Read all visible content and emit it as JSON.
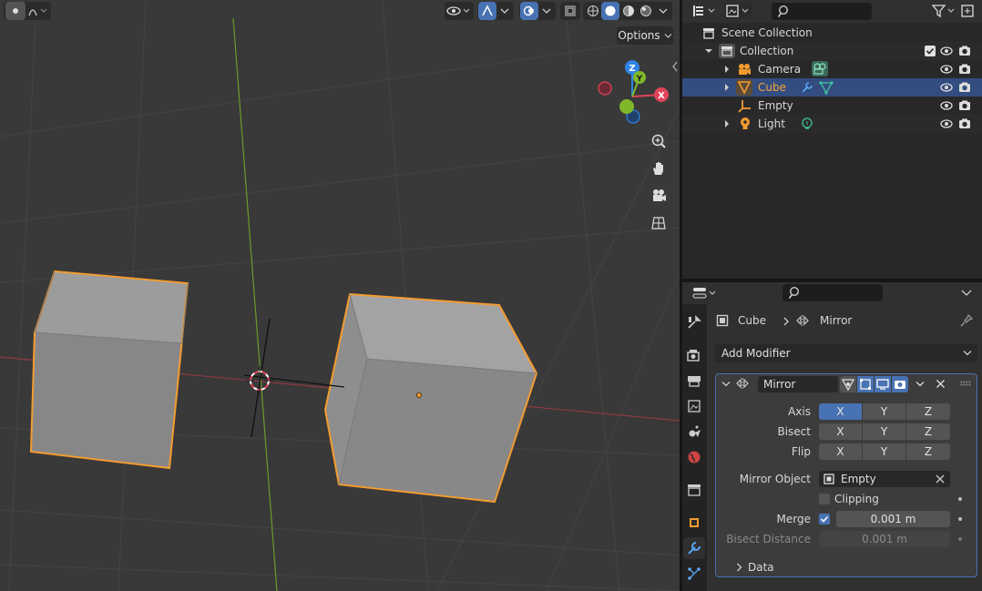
{
  "viewport": {
    "options_label": "Options",
    "gizmo": {
      "z": "Z",
      "y": "Y",
      "x": "X"
    }
  },
  "outliner": {
    "rows": [
      {
        "label": "Scene Collection",
        "icon": "scene-collection-icon"
      },
      {
        "label": "Collection",
        "icon": "collection-icon"
      },
      {
        "label": "Camera",
        "icon": "camera-object-icon"
      },
      {
        "label": "Cube",
        "icon": "mesh-object-icon",
        "selected": true
      },
      {
        "label": "Empty",
        "icon": "empty-object-icon"
      },
      {
        "label": "Light",
        "icon": "light-object-icon"
      }
    ]
  },
  "properties": {
    "breadcrumb": {
      "object": "Cube",
      "modifier": "Mirror"
    },
    "add_modifier": "Add Modifier",
    "modifier": {
      "name": "Mirror",
      "axis_label": "Axis",
      "bisect_label": "Bisect",
      "flip_label": "Flip",
      "x": "X",
      "y": "Y",
      "z": "Z",
      "mirror_object_label": "Mirror Object",
      "mirror_object_value": "Empty",
      "clipping_label": "Clipping",
      "merge_label": "Merge",
      "merge_value": "0.001 m",
      "bisect_distance_label": "Bisect Distance",
      "bisect_distance_value": "0.001 m",
      "data_label": "Data"
    }
  },
  "colors": {
    "selection_orange": "#f39c2f",
    "active_blue": "#4772b3",
    "axis_x": "#e1445a",
    "axis_y": "#7fb92b",
    "axis_z": "#2f84e3"
  }
}
